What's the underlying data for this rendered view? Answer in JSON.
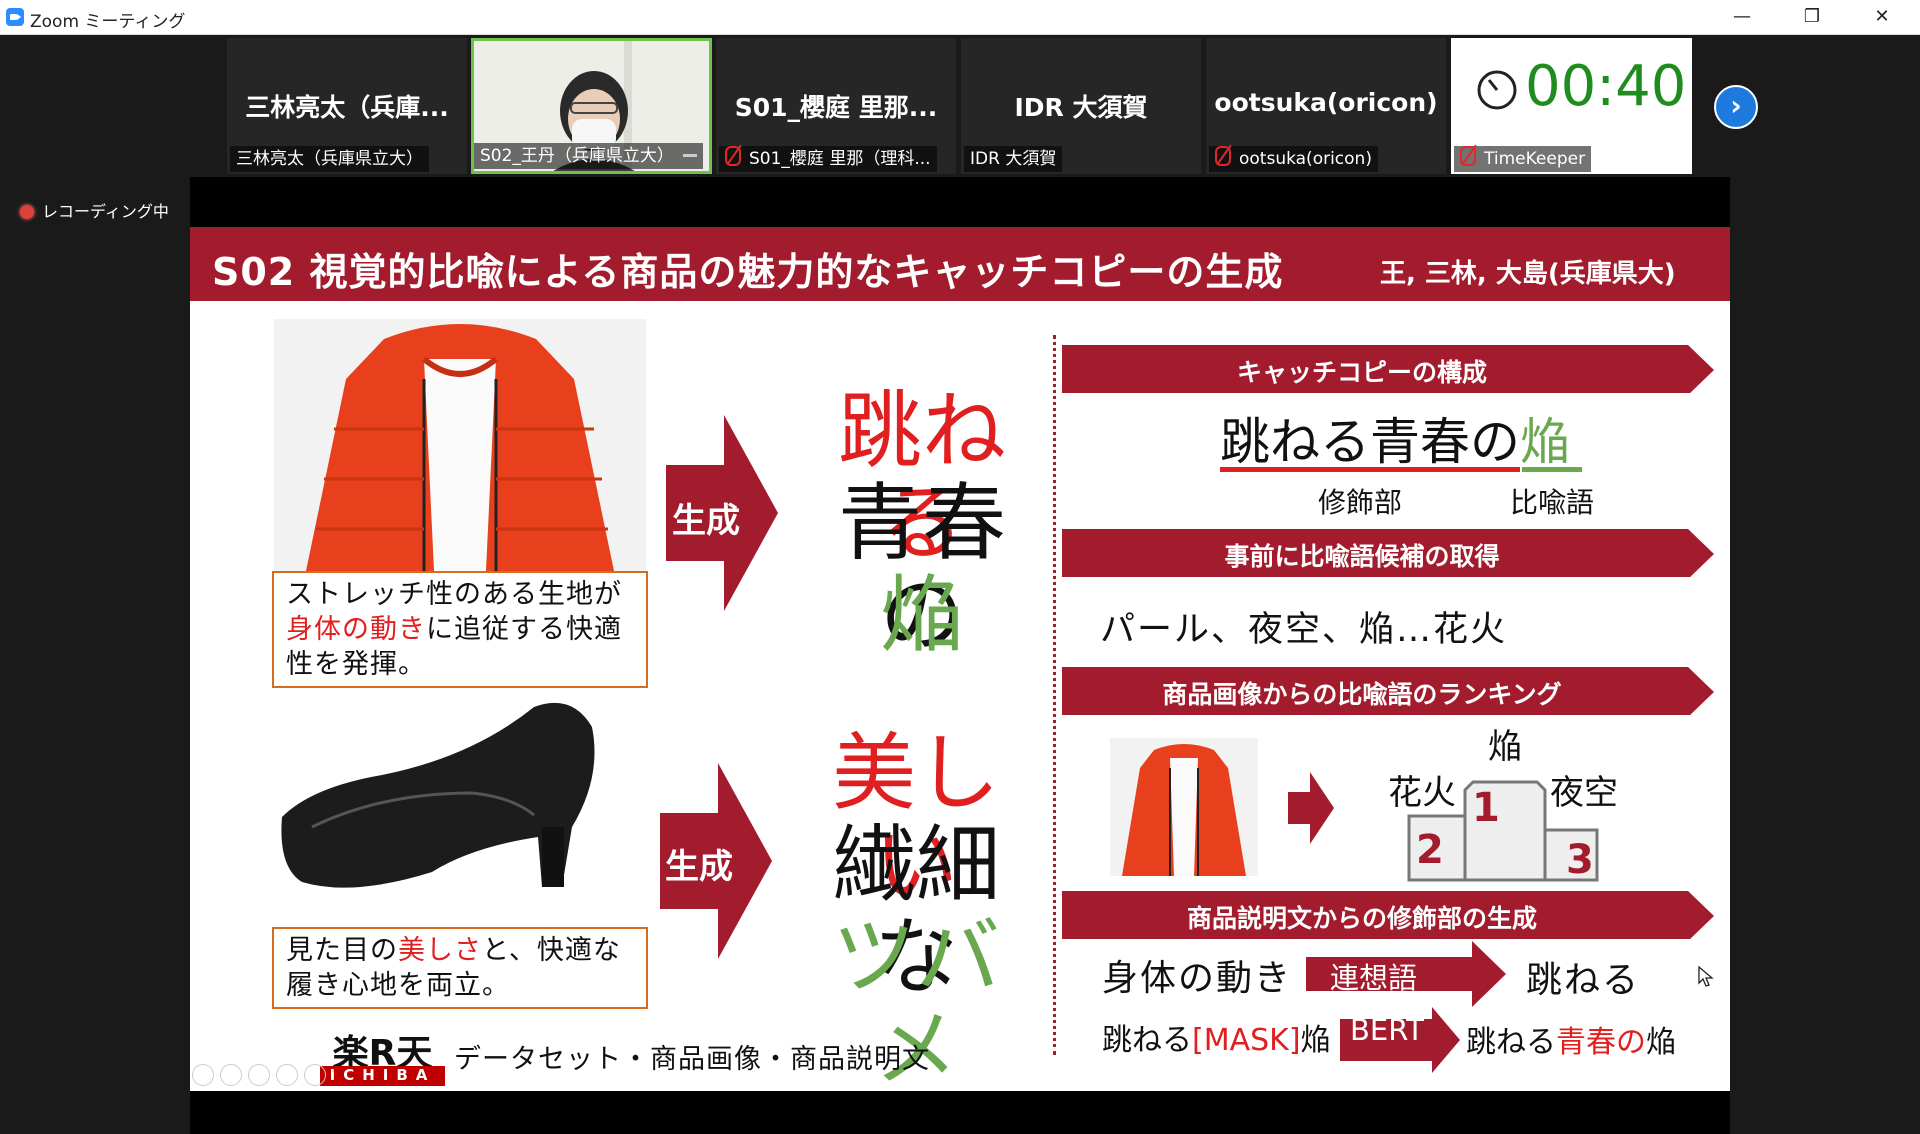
{
  "window": {
    "title": "Zoom ミーティング",
    "minimize": "—",
    "maximize": "❐",
    "close": "✕"
  },
  "participants": [
    {
      "display": "三林亮太（兵庫...",
      "label": "三林亮太（兵庫県立大）",
      "muted": false
    },
    {
      "display": "",
      "label": "S02_王丹（兵庫県立大）",
      "muted": false
    },
    {
      "display": "S01_櫻庭 里那...",
      "label": "S01_櫻庭 里那（理科...",
      "muted": true
    },
    {
      "display": "IDR 大須賀",
      "label": "IDR 大須賀",
      "muted": false
    },
    {
      "display": "ootsuka(oricon)",
      "label": "ootsuka(oricon)",
      "muted": true
    },
    {
      "display": "00:40",
      "label": "TimeKeeper",
      "muted": true
    }
  ],
  "recording": "レコーディング中",
  "slide": {
    "title": "S02 視覚的比喩による商品の魅力的なキャッチコピーの生成",
    "authors": "王, 三林, 大島(兵庫県大)",
    "example1": {
      "caption_pre": "ストレッチ性のある生地が",
      "caption_red": "身体の動き",
      "caption_post": "に追従する快適性を発揮。",
      "arrow_label": "生成",
      "word1": "跳ねる",
      "word2": "青春の",
      "word3": "焔"
    },
    "example2": {
      "caption_pre": "見た目の",
      "caption_red": "美しさ",
      "caption_post": "と、快適な履き心地を両立。",
      "arrow_label": "生成",
      "word1": "美しい",
      "word2": "繊細な",
      "word3": "ツバメ"
    },
    "rakuten": {
      "logo_top": "楽R天",
      "logo_bottom": "ICHIBA",
      "dataset": "データセット・商品画像・商品説明文"
    },
    "right": {
      "b1": "キャッチコピーの構成",
      "phrase_main": "跳ねる青春の",
      "phrase_end": "焔",
      "mod_label": "修飾部",
      "meta_label": "比喩語",
      "b2": "事前に比喩語候補の取得",
      "candidates": "パール、夜空、焔…花火",
      "b3": "商品画像からの比喩語のランキング",
      "rank1": "焔",
      "rank2": "花火",
      "rank3": "夜空",
      "n1": "1",
      "n2": "2",
      "n3": "3",
      "b4": "商品説明文からの修飾部の生成",
      "row1_left": "身体の動き",
      "row1_tag": "連想語",
      "row1_right": "跳ねる",
      "row2_left_pre": "跳ねる",
      "row2_left_mask": "[MASK]",
      "row2_left_post": "焔",
      "row2_tag": "BERT",
      "row2_right_pre": "跳ねる",
      "row2_right_red": "青春の",
      "row2_right_post": "焔"
    }
  },
  "colors": {
    "accent": "#a31c2e",
    "red": "#e02020",
    "green": "#6aa84f",
    "timer": "#1e8c1e"
  }
}
